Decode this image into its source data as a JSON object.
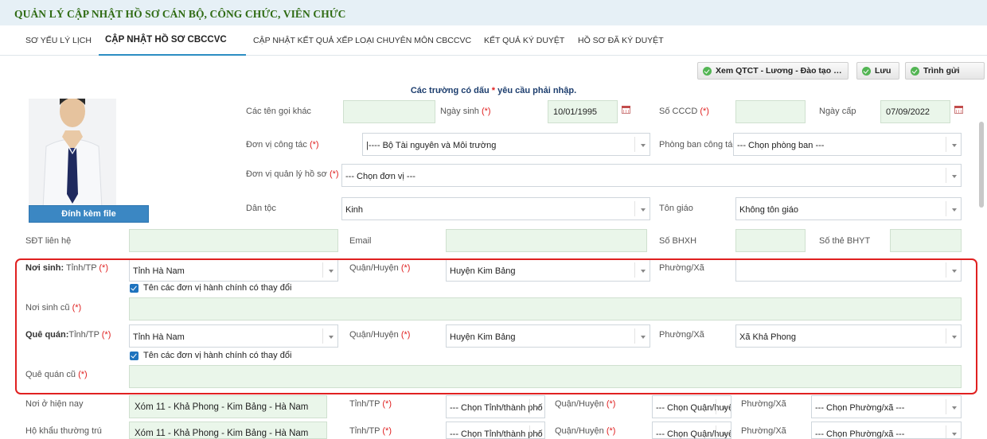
{
  "app": {
    "title": "QUẢN LÝ CẬP NHẬT HỒ SƠ CÁN BỘ, CÔNG CHỨC, VIÊN CHỨC"
  },
  "tabs": [
    {
      "label": "SƠ YẾU LÝ LỊCH"
    },
    {
      "label": "CẬP NHẬT HỒ SƠ CBCCVC",
      "active": true
    },
    {
      "label": "CẬP NHẬT KẾT QUẢ XẾP LOẠI CHUYÊN MÔN CBCCVC"
    },
    {
      "label": "KẾT QUẢ KÝ DUYỆT"
    },
    {
      "label": "HỒ SƠ ĐÃ KÝ DUYỆT"
    }
  ],
  "toolbar": {
    "view_label": "Xem QTCT - Lương - Đào tạo - QHGĐ...",
    "save_label": "Lưu",
    "submit_label": "Trình gửi"
  },
  "notice": {
    "before": "Các trường có dấu",
    "star": "*",
    "after": "yêu cầu phải nhập."
  },
  "attach_label": "Đính kèm file",
  "req_star": "(*)",
  "fields": {
    "other_names": {
      "label": "Các tên gọi khác",
      "value": ""
    },
    "dob": {
      "label": "Ngày sinh",
      "value": "10/01/1995"
    },
    "cccd": {
      "label": "Số CCCD",
      "value": ""
    },
    "issue_date": {
      "label": "Ngày cấp",
      "value": "07/09/2022"
    },
    "unit": {
      "label": "Đơn vị công tác",
      "value": "|---- Bộ Tài nguyên và Môi trường"
    },
    "department": {
      "label": "Phòng ban công tác",
      "value": "--- Chọn phòng ban ---"
    },
    "managing_unit": {
      "label": "Đơn vị quản lý hồ sơ",
      "value": "--- Chọn đơn vị ---"
    },
    "ethnicity": {
      "label": "Dân tộc",
      "value": "Kinh"
    },
    "religion": {
      "label": "Tôn giáo",
      "value": "Không tôn giáo"
    },
    "phone": {
      "label": "SĐT liên hệ",
      "value": ""
    },
    "email": {
      "label": "Email",
      "value": ""
    },
    "bhxh": {
      "label": "Số BHXH",
      "value": ""
    },
    "bhyt": {
      "label": "Số thẻ BHYT",
      "value": ""
    },
    "birthplace": {
      "bold": "Nơi sinh:",
      "label": "Tỉnh/TP",
      "province": "Tỉnh Hà Nam",
      "district_label": "Quận/Huyện",
      "district": "Huyện Kim Bảng",
      "ward_label": "Phường/Xã",
      "ward": "",
      "changed_label": "Tên các đơn vị hành chính có thay đổi",
      "old_label": "Nơi sinh cũ",
      "old_value": ""
    },
    "hometown": {
      "bold": "Quê quán:",
      "label": "Tỉnh/TP",
      "province": "Tỉnh Hà Nam",
      "district_label": "Quận/Huyện",
      "district": "Huyện Kim Bảng",
      "ward_label": "Phường/Xã",
      "ward": "Xã Khả Phong",
      "changed_label": "Tên các đơn vị hành chính có thay đổi",
      "old_label": "Quê quán cũ",
      "old_value": ""
    },
    "residence": {
      "label": "Nơi ở hiện nay",
      "value": "Xóm 11 - Khả Phong - Kim Bảng - Hà Nam",
      "province_label": "Tỉnh/TP",
      "province": "--- Chọn Tỉnh/thành phố ---",
      "district_label": "Quận/Huyện",
      "district": "--- Chọn Quận/huyện ---",
      "ward_label": "Phường/Xã",
      "ward": "--- Chọn Phường/xã ---"
    },
    "permanent": {
      "label": "Hộ khẩu thường trú",
      "value": "Xóm 11 - Khả Phong - Kim Bảng - Hà Nam",
      "province_label": "Tỉnh/TP",
      "province": "--- Chọn Tỉnh/thành phố ---",
      "district_label": "Quận/Huyện",
      "district": "--- Chọn Quận/huyện ---",
      "ward_label": "Phường/Xã",
      "ward": "--- Chọn Phường/xã ---"
    }
  },
  "colors": {
    "title_green": "#2f6b13",
    "accent_blue": "#2c8ec3",
    "highlight_red": "#e02020",
    "input_green": "#eaf6ea"
  }
}
